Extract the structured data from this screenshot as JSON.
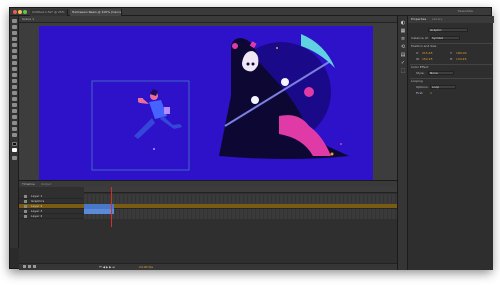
{
  "titlebar": {
    "tabs": [
      {
        "label": "Untitled-1.fla* @ 25%"
      },
      {
        "label": "Halloween Reels @ 100% (Canvas)"
      }
    ],
    "workspace_label": "Essentials"
  },
  "document": {
    "scene_label": "Scene 1"
  },
  "stage": {
    "background": "#2d12c9"
  },
  "timeline": {
    "tabs": [
      {
        "label": "Timeline"
      },
      {
        "label": "Output"
      }
    ],
    "layers": [
      {
        "name": "Layer 1"
      },
      {
        "name": "Graphics"
      },
      {
        "name": "Layer 4"
      },
      {
        "name": "Layer 3"
      },
      {
        "name": "Layer 2"
      }
    ],
    "frame_rate": "24.00 fps"
  },
  "properties": {
    "tabs": [
      {
        "label": "Properties"
      },
      {
        "label": "Library"
      }
    ],
    "instance_type": "Graphic",
    "instance_label": "Instance of:",
    "instance_value": "Symbol",
    "section_position": "Position and Size",
    "x_label": "X:",
    "x_value": "215.45",
    "y_label": "Y:",
    "y_value": "180.00",
    "w_label": "W:",
    "w_value": "152.25",
    "h_label": "H:",
    "h_value": "134.45",
    "section_color": "Color Effect",
    "style_label": "Style:",
    "style_value": "None",
    "section_looping": "Looping",
    "options_label": "Options:",
    "options_value": "Loop",
    "first_label": "First:",
    "first_value": "1"
  },
  "colors": {
    "accent": "#e5a23a",
    "stage": "#2d12c9",
    "selection": "#4a78c8"
  }
}
